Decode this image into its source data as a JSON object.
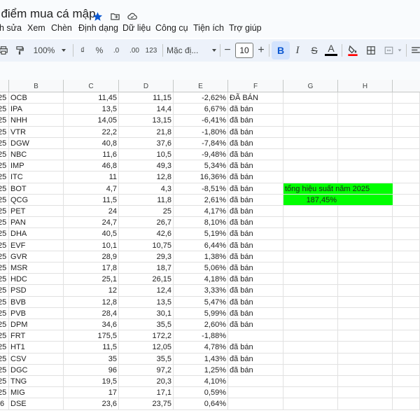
{
  "document": {
    "title": "t điểm mua cá mập"
  },
  "icons": {
    "star": "star-icon",
    "move": "move-to-folder-icon",
    "cloud": "cloud-status-icon"
  },
  "accent_color": "#0b57d0",
  "highlight_color": "#00ff00",
  "menu": [
    "h sửa",
    "Xem",
    "Chèn",
    "Định dạng",
    "Dữ liệu",
    "Công cụ",
    "Tiện ích",
    "Trợ giúp"
  ],
  "toolbar": {
    "zoom": "100%",
    "currency": "₫",
    "percent": "%",
    "decrease_decimal": ".0",
    "increase_decimal": ".00",
    "number_format": "123",
    "font_name": "Mặc đị...",
    "font_size": "10",
    "bold": "B",
    "italic": "I",
    "strikethrough": "S",
    "text_color": "A"
  },
  "columns": [
    "B",
    "C",
    "D",
    "E",
    "F",
    "G",
    "H"
  ],
  "rows": [
    {
      "a": "25",
      "b": "OCB",
      "c": "11,45",
      "d": "11,15",
      "e": "-2,62%",
      "f": "ĐÃ BÁN"
    },
    {
      "a": "25",
      "b": "IPA",
      "c": "13,5",
      "d": "14,4",
      "e": "6,67%",
      "f": "đã bán"
    },
    {
      "a": "25",
      "b": "NHH",
      "c": "14,05",
      "d": "13,15",
      "e": "-6,41%",
      "f": "đã bán"
    },
    {
      "a": "25",
      "b": "VTR",
      "c": "22,2",
      "d": "21,8",
      "e": "-1,80%",
      "f": "đã bán"
    },
    {
      "a": "25",
      "b": "DGW",
      "c": "40,8",
      "d": "37,6",
      "e": "-7,84%",
      "f": "đã bán"
    },
    {
      "a": "25",
      "b": "NBC",
      "c": "11,6",
      "d": "10,5",
      "e": "-9,48%",
      "f": "đã bán"
    },
    {
      "a": "25",
      "b": "IMP",
      "c": "46,8",
      "d": "49,3",
      "e": "5,34%",
      "f": "đã bán"
    },
    {
      "a": "25",
      "b": "ITC",
      "c": "11",
      "d": "12,8",
      "e": "16,36%",
      "f": "đã bán"
    },
    {
      "a": "25",
      "b": "BOT",
      "c": "4,7",
      "d": "4,3",
      "e": "-8,51%",
      "f": "đã bán"
    },
    {
      "a": "25",
      "b": "QCG",
      "c": "11,5",
      "d": "11,8",
      "e": "2,61%",
      "f": "đã bán"
    },
    {
      "a": "25",
      "b": "PET",
      "c": "24",
      "d": "25",
      "e": "4,17%",
      "f": "đã bán"
    },
    {
      "a": "25",
      "b": "PAN",
      "c": "24,7",
      "d": "26,7",
      "e": "8,10%",
      "f": "đã bán"
    },
    {
      "a": "25",
      "b": "DHA",
      "c": "40,5",
      "d": "42,6",
      "e": "5,19%",
      "f": "đã bán"
    },
    {
      "a": "25",
      "b": "EVF",
      "c": "10,1",
      "d": "10,75",
      "e": "6,44%",
      "f": "đã bán"
    },
    {
      "a": "25",
      "b": "GVR",
      "c": "28,9",
      "d": "29,3",
      "e": "1,38%",
      "f": "đã bán"
    },
    {
      "a": "25",
      "b": "MSR",
      "c": "17,8",
      "d": "18,7",
      "e": "5,06%",
      "f": "đã bán"
    },
    {
      "a": "25",
      "b": "HDC",
      "c": "25,1",
      "d": "26,15",
      "e": "4,18%",
      "f": "đã bán"
    },
    {
      "a": "25",
      "b": "PSD",
      "c": "12",
      "d": "12,4",
      "e": "3,33%",
      "f": "đã bán"
    },
    {
      "a": "25",
      "b": "BVB",
      "c": "12,8",
      "d": "13,5",
      "e": "5,47%",
      "f": "đã bán"
    },
    {
      "a": "25",
      "b": "PVB",
      "c": "28,4",
      "d": "30,1",
      "e": "5,99%",
      "f": "đã bán"
    },
    {
      "a": "25",
      "b": "DPM",
      "c": "34,6",
      "d": "35,5",
      "e": "2,60%",
      "f": "đã bán"
    },
    {
      "a": "25",
      "b": "FRT",
      "c": "175,5",
      "d": "172,2",
      "e": "-1,88%",
      "f": ""
    },
    {
      "a": "25",
      "b": "HT1",
      "c": "11,5",
      "d": "12,05",
      "e": "4,78%",
      "f": "đã bán"
    },
    {
      "a": "25",
      "b": "CSV",
      "c": "35",
      "d": "35,5",
      "e": "1,43%",
      "f": "đã bán"
    },
    {
      "a": "25",
      "b": "DGC",
      "c": "96",
      "d": "97,2",
      "e": "1,25%",
      "f": "đã bán"
    },
    {
      "a": "25",
      "b": "TNG",
      "c": "19,5",
      "d": "20,3",
      "e": "4,10%",
      "f": ""
    },
    {
      "a": "25",
      "b": "MIG",
      "c": "17",
      "d": "17,1",
      "e": "0,59%",
      "f": ""
    },
    {
      "a": "/6",
      "b": "DSE",
      "c": "23,6",
      "d": "23,75",
      "e": "0,64%",
      "f": ""
    }
  ],
  "summary": {
    "label": "tổng hiệu suất năm 2025",
    "value": "187,45%"
  }
}
